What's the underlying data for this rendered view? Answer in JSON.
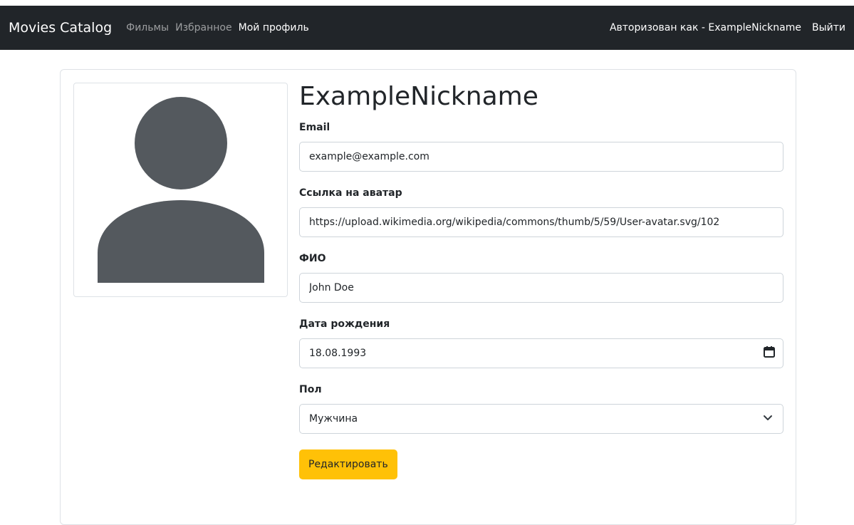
{
  "navbar": {
    "brand": "Movies Catalog",
    "links": [
      {
        "label": "Фильмы",
        "active": false
      },
      {
        "label": "Избранное",
        "active": false
      },
      {
        "label": "Мой профиль",
        "active": true
      }
    ],
    "user_text": "Авторизован как - ExampleNickname",
    "logout": "Выйти"
  },
  "profile": {
    "nickname": "ExampleNickname",
    "avatar_icon": "user-avatar-icon",
    "fields": {
      "email": {
        "label": "Email",
        "value": "example@example.com"
      },
      "avatar_link": {
        "label": "Ссылка на аватар",
        "value": "https://upload.wikimedia.org/wikipedia/commons/thumb/5/59/User-avatar.svg/102"
      },
      "full_name": {
        "label": "ФИО",
        "value": "John Doe"
      },
      "birth_date": {
        "label": "Дата рождения",
        "value": "18.08.1993",
        "icon": "calendar-icon"
      },
      "gender": {
        "label": "Пол",
        "value": "Мужчина",
        "icon": "chevron-down-icon"
      }
    },
    "edit_button": "Редактировать"
  },
  "colors": {
    "navbar_bg": "#212529",
    "button_bg": "#ffc107",
    "avatar_fill": "#54595e",
    "border": "#dee2e6"
  }
}
